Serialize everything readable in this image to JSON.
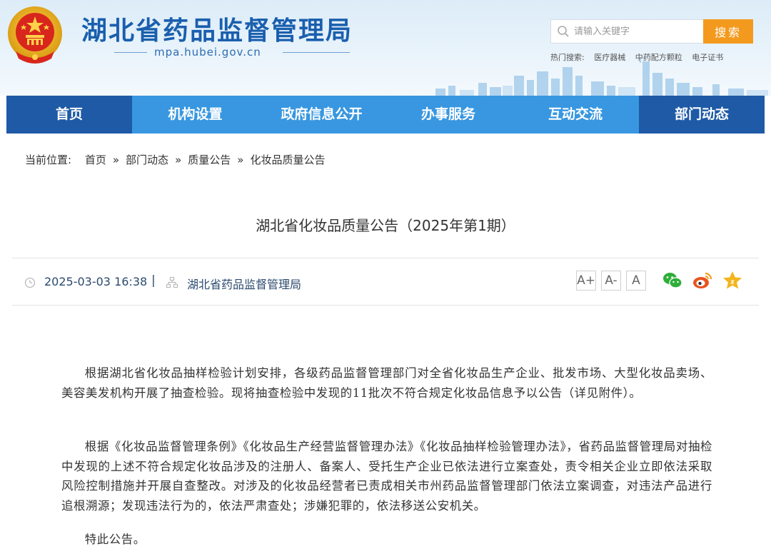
{
  "header": {
    "site_title": "湖北省药品监督管理局",
    "domain": "mpa.hubei.gov.cn",
    "search": {
      "placeholder": "请输入关键字",
      "button_label": "搜索",
      "hot_label": "热门搜索:",
      "hot_keywords": [
        "医疗器械",
        "中药配方颗粒",
        "电子证书"
      ]
    },
    "colors": {
      "title": "#1a5fae",
      "search_button": "#f39a1e"
    }
  },
  "nav": {
    "items": [
      {
        "label": "首页",
        "active": true
      },
      {
        "label": "机构设置",
        "active": false
      },
      {
        "label": "政府信息公开",
        "active": false
      },
      {
        "label": "办事服务",
        "active": false
      },
      {
        "label": "互动交流",
        "active": false
      },
      {
        "label": "部门动态",
        "active": true
      }
    ],
    "colors": {
      "bar": "#3897e0",
      "active": "#1e5aa6"
    }
  },
  "breadcrumb": {
    "label": "当前位置:",
    "items": [
      "首页",
      "部门动态",
      "质量公告",
      "化妆品质量公告"
    ],
    "separator": "»"
  },
  "article": {
    "title": "湖北省化妆品质量公告（2025年第1期）",
    "date": "2025-03-03 16:38",
    "divider": "|",
    "source": "湖北省药品监督管理局",
    "font_controls": [
      "A+",
      "A-",
      "A"
    ],
    "share_icons": [
      "wechat-icon",
      "weibo-icon",
      "favorite-icon"
    ],
    "paragraphs": [
      "根据湖北省化妆品抽样检验计划安排，各级药品监督管理部门对全省化妆品生产企业、批发市场、大型化妆品卖场、美容美发机构开展了抽查检验。现将抽查检验中发现的11批次不符合规定化妆品信息予以公告（详见附件）。",
      "根据《化妆品监督管理条例》《化妆品生产经营监督管理办法》《化妆品抽样检验管理办法》，省药品监督管理局对抽检中发现的上述不符合规定化妆品涉及的注册人、备案人、受托生产企业已依法进行立案查处，责令相关企业立即依法采取风险控制措施并开展自查整改。对涉及的化妆品经营者已责成相关市州药品监督管理部门依法立案调查，对违法产品进行追根溯源；发现违法行为的，依法严肃查处；涉嫌犯罪的，依法移送公安机关。",
      "特此公告。"
    ]
  }
}
